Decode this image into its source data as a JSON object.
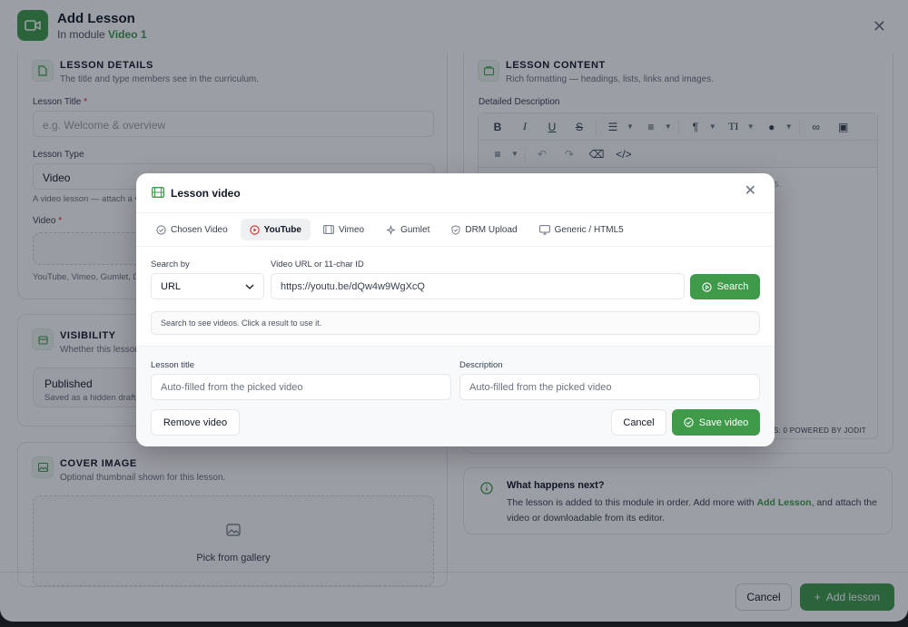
{
  "colors": {
    "accent": "#3f9a4a",
    "required": "#dc2626"
  },
  "background": {
    "title": "Add Lesson",
    "subtitle_prefix": "In module",
    "subtitle_module": "Video 1",
    "details": {
      "title": "LESSON DETAILS",
      "subtitle": "The title and type members see in the curriculum.",
      "lesson_title_label": "Lesson Title",
      "lesson_title_placeholder": "e.g. Welcome & overview",
      "lesson_type_label": "Lesson Type",
      "lesson_type_value": "Video",
      "lesson_type_help": "A video lesson — attach a v",
      "video_label": "Video",
      "video_help": "YouTube, Vimeo, Gumlet, DRM"
    },
    "visibility": {
      "title": "VISIBILITY",
      "subtitle": "Whether this lesson",
      "status": "Published",
      "status_help": "Saved as a hidden draft"
    },
    "cover": {
      "title": "COVER IMAGE",
      "subtitle": "Optional thumbnail shown for this lesson.",
      "pick_label": "Pick from gallery"
    },
    "content": {
      "title": "LESSON CONTENT",
      "subtitle": "Rich formatting — headings, lists, links and images.",
      "description_label": "Detailed Description",
      "editor_peek": "s.",
      "powered_by": "S: 0   POWERED BY JODIT"
    },
    "info": {
      "title": "What happens next?",
      "body_start": "The lesson is added to this module in order. Add more with ",
      "body_link": "Add Lesson",
      "body_end": ", and attach the video or downloadable from its editor."
    },
    "footer": {
      "cancel": "Cancel",
      "add": "Add lesson"
    }
  },
  "modal": {
    "title": "Lesson video",
    "tabs": [
      {
        "label": "Chosen Video",
        "icon": "check-circle-icon"
      },
      {
        "label": "YouTube",
        "icon": "youtube-play-icon"
      },
      {
        "label": "Vimeo",
        "icon": "film-icon"
      },
      {
        "label": "Gumlet",
        "icon": "sparkle-icon"
      },
      {
        "label": "DRM Upload",
        "icon": "shield-check-icon"
      },
      {
        "label": "Generic / HTML5",
        "icon": "monitor-icon"
      }
    ],
    "active_tab": "YouTube",
    "search_by_label": "Search by",
    "search_by_value": "URL",
    "url_label": "Video URL or 11-char ID",
    "url_value": "https://youtu.be/dQw4w9WgXcQ",
    "search_button": "Search",
    "hint": "Search to see videos. Click a result to use it.",
    "lesson_title_label": "Lesson title",
    "lesson_title_placeholder": "Auto-filled from the picked video",
    "description_label": "Description",
    "description_placeholder": "Auto-filled from the picked video",
    "remove_button": "Remove video",
    "cancel_button": "Cancel",
    "save_button": "Save video"
  }
}
